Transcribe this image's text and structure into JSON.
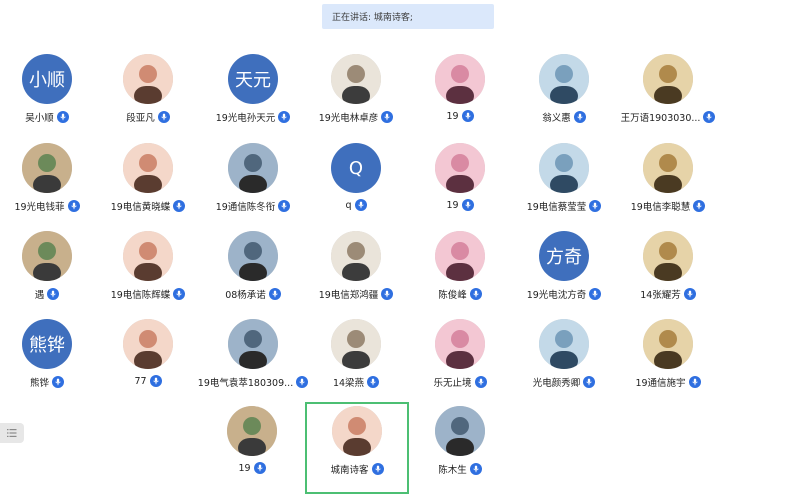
{
  "status": {
    "speaking_label": "正在讲话: 城南诗客;"
  },
  "participants": [
    {
      "name": "吴小顺",
      "avatar": {
        "type": "text",
        "text": "小顺"
      }
    },
    {
      "name": "段亚凡",
      "avatar": {
        "type": "photo",
        "hint": "totoro-illustration"
      }
    },
    {
      "name": "19光电孙天元",
      "avatar": {
        "type": "text",
        "text": "天元"
      }
    },
    {
      "name": "19光电林卓彦",
      "avatar": {
        "type": "photo",
        "hint": "sketch-portrait"
      }
    },
    {
      "name": "19",
      "avatar": {
        "type": "photo",
        "hint": "city-skyline"
      }
    },
    {
      "name": "翁义惠",
      "avatar": {
        "type": "photo",
        "hint": "street-photo"
      }
    },
    {
      "name": "王万语1903030...",
      "avatar": {
        "type": "photo",
        "hint": "cartoon-face"
      }
    },
    {
      "name": "19光电钱菲",
      "avatar": {
        "type": "photo",
        "hint": "baby-photo"
      }
    },
    {
      "name": "19电信黄晓蝶",
      "avatar": {
        "type": "photo",
        "hint": "outdoor-photo"
      }
    },
    {
      "name": "19通信陈冬衔",
      "avatar": {
        "type": "photo",
        "hint": "manga-drawing"
      }
    },
    {
      "name": "q",
      "avatar": {
        "type": "text",
        "text": "Q"
      }
    },
    {
      "name": "19",
      "avatar": {
        "type": "photo",
        "hint": "portrait"
      }
    },
    {
      "name": "19电信蔡莹莹",
      "avatar": {
        "type": "photo",
        "hint": "anime-character"
      }
    },
    {
      "name": "19电信李聪慧",
      "avatar": {
        "type": "photo",
        "hint": "child-photo"
      }
    },
    {
      "name": "遇",
      "avatar": {
        "type": "photo",
        "hint": "dark-portrait"
      }
    },
    {
      "name": "19电信陈辉蝶",
      "avatar": {
        "type": "photo",
        "hint": "line-drawing-girl"
      }
    },
    {
      "name": "08杨承诺",
      "avatar": {
        "type": "photo",
        "hint": "cat-photo"
      }
    },
    {
      "name": "19电信郑鸿疆",
      "avatar": {
        "type": "photo",
        "hint": "anime-girl"
      }
    },
    {
      "name": "陈俊峰",
      "avatar": {
        "type": "photo",
        "hint": "manga-boy"
      }
    },
    {
      "name": "19光电沈方奇",
      "avatar": {
        "type": "text",
        "text": "方奇"
      }
    },
    {
      "name": "14张耀芳",
      "avatar": {
        "type": "photo",
        "hint": "toddler-photo"
      }
    },
    {
      "name": "熊铧",
      "avatar": {
        "type": "text",
        "text": "熊铧"
      }
    },
    {
      "name": "77",
      "avatar": {
        "type": "photo",
        "hint": "baby-pink-hat"
      }
    },
    {
      "name": "19电气袁萃180309...",
      "avatar": {
        "type": "photo",
        "hint": "bride-photo"
      }
    },
    {
      "name": "14梁燕",
      "avatar": {
        "type": "photo",
        "hint": "cartoon-scooter"
      }
    },
    {
      "name": "乐无止境",
      "avatar": {
        "type": "photo",
        "hint": "flower-photo"
      }
    },
    {
      "name": "光电颜秀卿",
      "avatar": {
        "type": "photo",
        "hint": "girl-photo"
      }
    },
    {
      "name": "19通信施宇",
      "avatar": {
        "type": "photo",
        "hint": "anime-sticker"
      }
    },
    {
      "name": "19",
      "avatar": {
        "type": "photo",
        "hint": "cartoon-penguin"
      }
    },
    {
      "name": "城南诗客",
      "avatar": {
        "type": "photo",
        "hint": "cartoon-man-glasses"
      },
      "active": true
    },
    {
      "name": "陈木生",
      "avatar": {
        "type": "photo",
        "hint": "couple-drawing"
      }
    }
  ],
  "colors": {
    "avatar_text_bg": "#3f6fbd",
    "mic_badge": "#2f6fe0",
    "active_border": "#4cbf73",
    "banner_bg": "#dbe8fb"
  },
  "icons": {
    "mic": "microphone-icon",
    "menu": "list-menu-icon"
  }
}
